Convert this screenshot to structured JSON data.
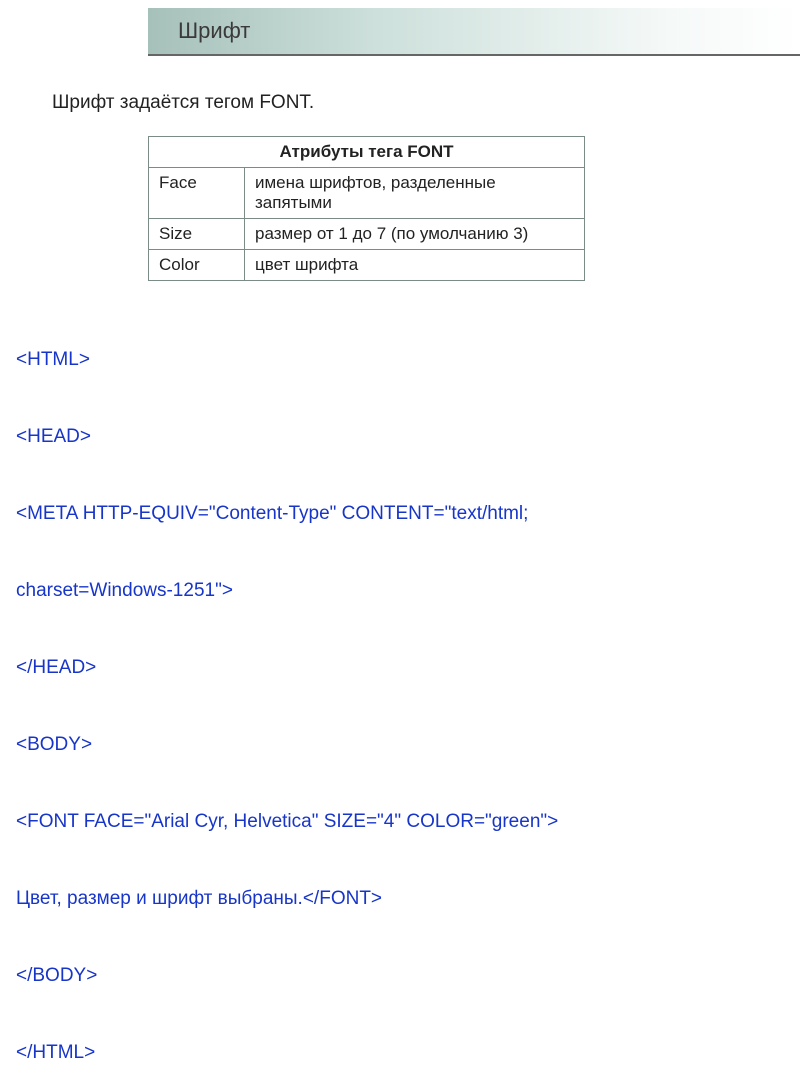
{
  "title": "Шрифт",
  "intro": "Шрифт задаётся тегом FONT.",
  "table": {
    "header": "Атрибуты тега FONT",
    "rows": [
      {
        "attr": "Face",
        "desc": "имена шрифтов, разделенные запятыми"
      },
      {
        "attr": "Size",
        "desc": "размер от 1 до 7 (по умолчанию 3)"
      },
      {
        "attr": "Color",
        "desc": "цвет шрифта"
      }
    ]
  },
  "code_lines": [
    "<HTML>",
    "<HEAD>",
    "<META HTTP-EQUIV=\"Content-Type\" CONTENT=\"text/html;",
    "charset=Windows-1251\">",
    "</HEAD>",
    "<BODY>",
    "<FONT FACE=\"Arial Cyr, Helvetica\" SIZE=\"4\" COLOR=\"green\">",
    "Цвет, размер и шрифт выбраны.</FONT>",
    "</BODY>",
    "</HTML>"
  ]
}
